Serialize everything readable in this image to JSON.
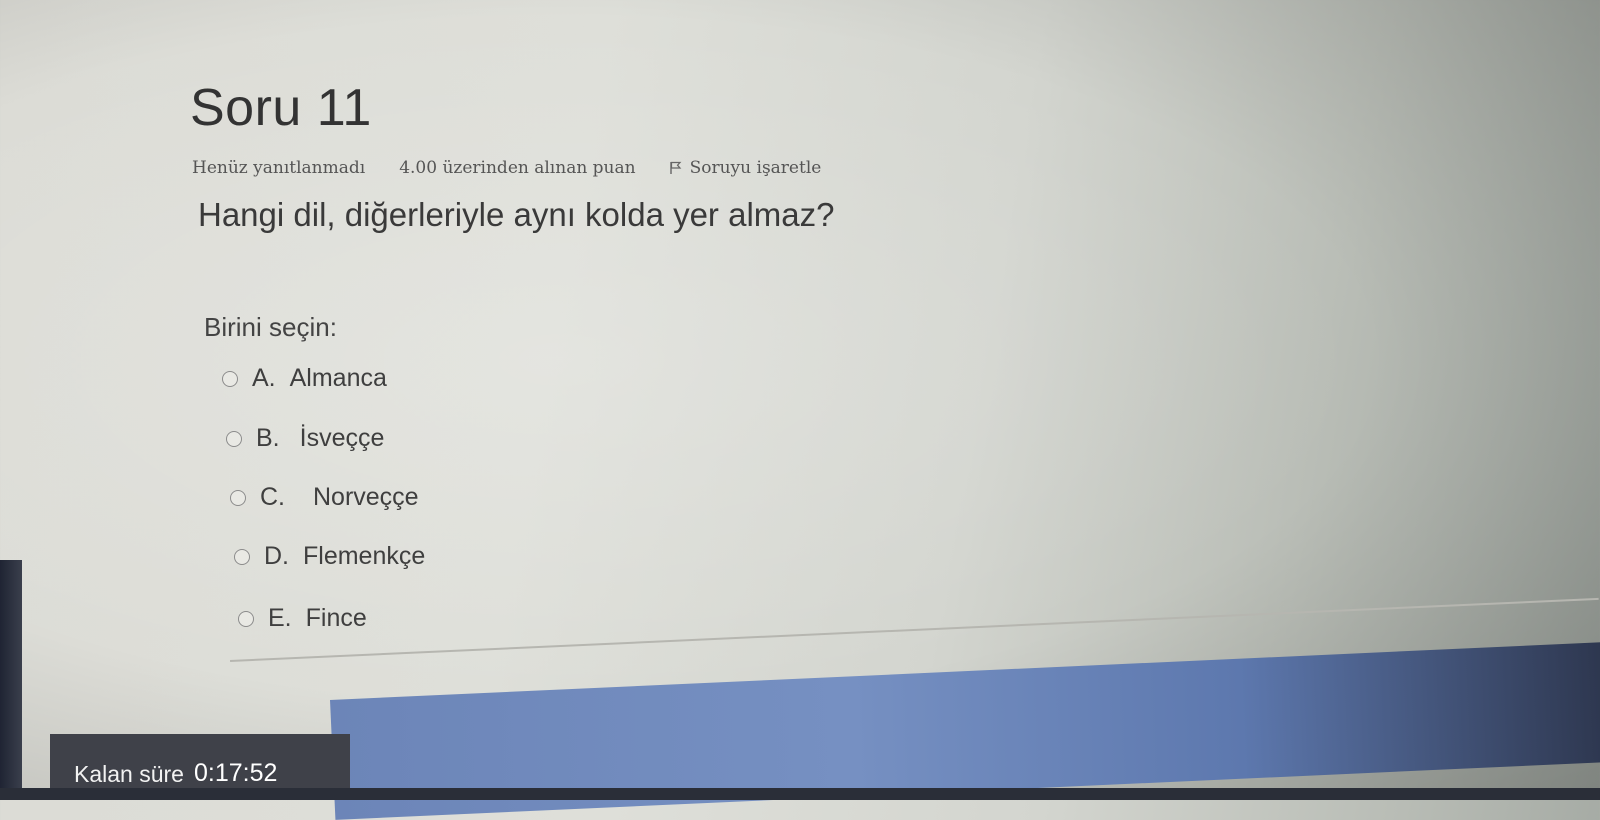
{
  "question": {
    "title": "Soru 11",
    "status": "Henüz yanıtlanmadı",
    "points": "4.00 üzerinden alınan puan",
    "flag_label": "Soruyu işaretle",
    "text": "Hangi dil, diğerleriyle aynı kolda yer almaz?",
    "prompt": "Birini seçin:",
    "options": [
      {
        "letter": "A.",
        "label": "Almanca"
      },
      {
        "letter": "B.",
        "label": "İsveççe"
      },
      {
        "letter": "C.",
        "label": "Norveççe"
      },
      {
        "letter": "D.",
        "label": "Flemenkçe"
      },
      {
        "letter": "E.",
        "label": "Fince"
      }
    ]
  },
  "timer": {
    "label": "Kalan süre",
    "value": "0:17:52"
  },
  "icons": {
    "flag": "flag-icon",
    "radio": "radio-button-icon"
  }
}
